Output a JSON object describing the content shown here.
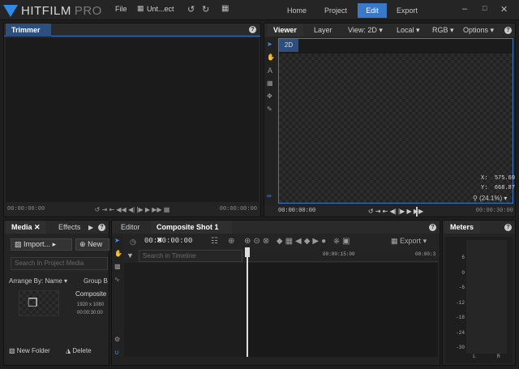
{
  "app": {
    "brand": "HITFILM",
    "edition": "PRO",
    "accent": "#3a78c8"
  },
  "menu": {
    "file": "File",
    "project_name": "Unt...ect"
  },
  "main_tabs": {
    "home": "Home",
    "project": "Project",
    "edit": "Edit",
    "export": "Export"
  },
  "trimmer": {
    "title": "Trimmer",
    "help": "?",
    "tc_start": "00:00:00:00",
    "tc_end": "00:00:00:00"
  },
  "viewer": {
    "tabs": {
      "viewer": "Viewer",
      "layer": "Layer"
    },
    "view_dropdown": "View: 2D",
    "space_dropdown": "Local",
    "channel_dropdown": "RGB",
    "options_dropdown": "Options",
    "help": "?",
    "mode_badge": "2D",
    "coord_x_label": "X:",
    "coord_x": "575.69",
    "coord_y_label": "Y:",
    "coord_y": "668.87",
    "zoom": "(24.1%)",
    "tc_start": "00:00:00:00",
    "tc_end": "00:00:30:00"
  },
  "media": {
    "tabs": {
      "media": "Media",
      "effects": "Effects"
    },
    "import_btn": "Import...",
    "new_btn": "New",
    "search_placeholder": "Search In Project Media",
    "arrange_label": "Arrange By: Name",
    "group_label": "Group B",
    "item": {
      "name": "Composite",
      "res": "1920 x 1080",
      "dur": "00:00:30:00"
    },
    "new_folder": "New Folder",
    "delete": "Delete"
  },
  "editor": {
    "tabs": {
      "editor": "Editor",
      "composite": "Composite Shot 1"
    },
    "timecode": "00:00:00:00",
    "export_btn": "Export",
    "search_placeholder": "Search in Timeline",
    "ruler_mark": "00:00:15:00",
    "ruler_end": "00:00:3"
  },
  "meters": {
    "title": "Meters",
    "scale": [
      "6",
      "0",
      "-6",
      "-12",
      "-18",
      "-24",
      "-30"
    ],
    "left": "L",
    "right": "R"
  }
}
